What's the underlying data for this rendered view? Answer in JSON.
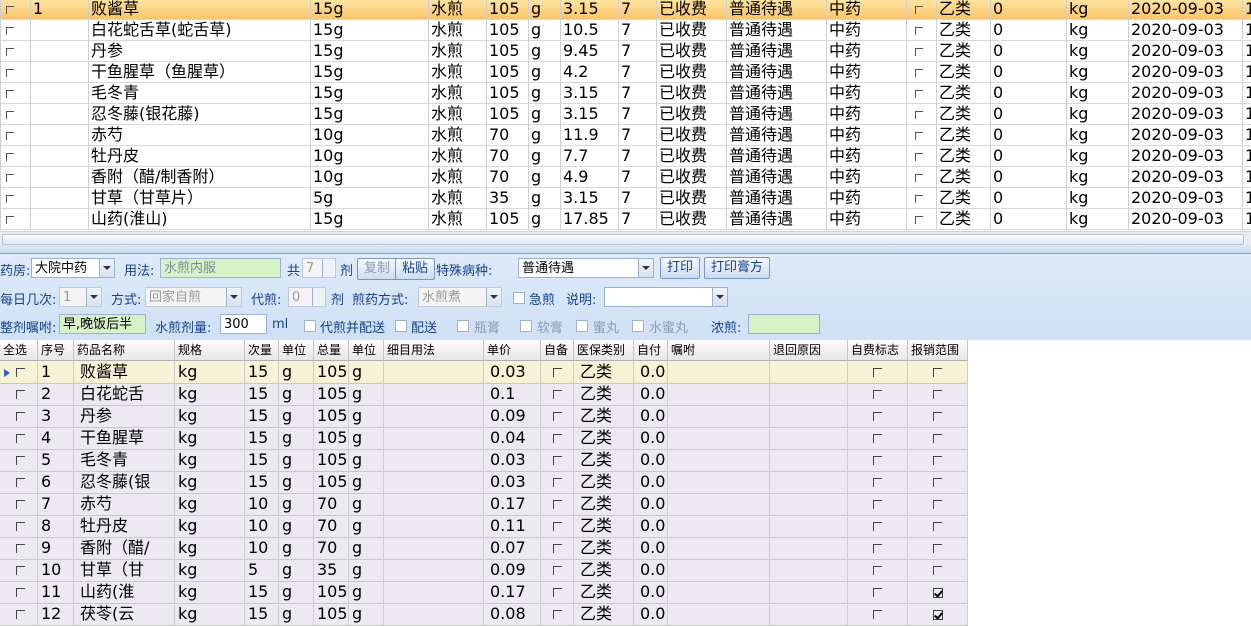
{
  "top_grid": {
    "rows": [
      {
        "no": "1",
        "name": "败酱草",
        "dose": "15g",
        "method": "水煎",
        "qty": "105",
        "unit": "g",
        "price": "3.15",
        "days": "7",
        "status": "已收费",
        "treatment": "普通待遇",
        "kind": "中药",
        "class": "乙类",
        "zero": "0",
        "u2": "kg",
        "date": "2020-09-03",
        "tail": "1"
      },
      {
        "no": "",
        "name": "白花蛇舌草(蛇舌草)",
        "dose": "15g",
        "method": "水煎",
        "qty": "105",
        "unit": "g",
        "price": "10.5",
        "days": "7",
        "status": "已收费",
        "treatment": "普通待遇",
        "kind": "中药",
        "class": "乙类",
        "zero": "0",
        "u2": "kg",
        "date": "2020-09-03",
        "tail": "1"
      },
      {
        "no": "",
        "name": "丹参",
        "dose": "15g",
        "method": "水煎",
        "qty": "105",
        "unit": "g",
        "price": "9.45",
        "days": "7",
        "status": "已收费",
        "treatment": "普通待遇",
        "kind": "中药",
        "class": "乙类",
        "zero": "0",
        "u2": "kg",
        "date": "2020-09-03",
        "tail": "1"
      },
      {
        "no": "",
        "name": "干鱼腥草（鱼腥草）",
        "dose": "15g",
        "method": "水煎",
        "qty": "105",
        "unit": "g",
        "price": "4.2",
        "days": "7",
        "status": "已收费",
        "treatment": "普通待遇",
        "kind": "中药",
        "class": "乙类",
        "zero": "0",
        "u2": "kg",
        "date": "2020-09-03",
        "tail": "1"
      },
      {
        "no": "",
        "name": "毛冬青",
        "dose": "15g",
        "method": "水煎",
        "qty": "105",
        "unit": "g",
        "price": "3.15",
        "days": "7",
        "status": "已收费",
        "treatment": "普通待遇",
        "kind": "中药",
        "class": "乙类",
        "zero": "0",
        "u2": "kg",
        "date": "2020-09-03",
        "tail": "1"
      },
      {
        "no": "",
        "name": "忍冬藤(银花藤)",
        "dose": "15g",
        "method": "水煎",
        "qty": "105",
        "unit": "g",
        "price": "3.15",
        "days": "7",
        "status": "已收费",
        "treatment": "普通待遇",
        "kind": "中药",
        "class": "乙类",
        "zero": "0",
        "u2": "kg",
        "date": "2020-09-03",
        "tail": "1"
      },
      {
        "no": "",
        "name": "赤芍",
        "dose": "10g",
        "method": "水煎",
        "qty": "70",
        "unit": "g",
        "price": "11.9",
        "days": "7",
        "status": "已收费",
        "treatment": "普通待遇",
        "kind": "中药",
        "class": "乙类",
        "zero": "0",
        "u2": "kg",
        "date": "2020-09-03",
        "tail": "1"
      },
      {
        "no": "",
        "name": "牡丹皮",
        "dose": "10g",
        "method": "水煎",
        "qty": "70",
        "unit": "g",
        "price": "7.7",
        "days": "7",
        "status": "已收费",
        "treatment": "普通待遇",
        "kind": "中药",
        "class": "乙类",
        "zero": "0",
        "u2": "kg",
        "date": "2020-09-03",
        "tail": "1"
      },
      {
        "no": "",
        "name": "香附（醋/制香附）",
        "dose": "10g",
        "method": "水煎",
        "qty": "70",
        "unit": "g",
        "price": "4.9",
        "days": "7",
        "status": "已收费",
        "treatment": "普通待遇",
        "kind": "中药",
        "class": "乙类",
        "zero": "0",
        "u2": "kg",
        "date": "2020-09-03",
        "tail": "1"
      },
      {
        "no": "",
        "name": "甘草（甘草片）",
        "dose": "5g",
        "method": "水煎",
        "qty": "35",
        "unit": "g",
        "price": "3.15",
        "days": "7",
        "status": "已收费",
        "treatment": "普通待遇",
        "kind": "中药",
        "class": "乙类",
        "zero": "0",
        "u2": "kg",
        "date": "2020-09-03",
        "tail": "1"
      },
      {
        "no": "",
        "name": "山药(淮山)",
        "dose": "15g",
        "method": "水煎",
        "qty": "105",
        "unit": "g",
        "price": "17.85",
        "days": "7",
        "status": "已收费",
        "treatment": "普通待遇",
        "kind": "中药",
        "class": "乙类",
        "zero": "0",
        "u2": "kg",
        "date": "2020-09-03",
        "tail": "1"
      }
    ]
  },
  "form": {
    "pharmacy_label": "药房:",
    "pharmacy_value": "大院中药",
    "usage_label": "用法:",
    "usage_value": "水煎内服",
    "total_label": "共",
    "total_value": "7",
    "dose_unit": "剂",
    "copy_label": "复制",
    "paste_label": "粘贴",
    "special_label": "特殊病种:",
    "special_value": "普通待遇",
    "print_label": "打印",
    "print_paste_label": "打印膏方",
    "times_label": "每日几次:",
    "times_value": "1",
    "mode_label": "方式:",
    "mode_value": "回家自煎",
    "proxy_label": "代煎:",
    "proxy_value": "0",
    "proxy_unit": "剂",
    "decoct_label": "煎药方式:",
    "decoct_value": "水煎煮",
    "urgent_label": "急煎",
    "note_label": "说明:",
    "note_value": "",
    "advice_label": "整剂嘱咐:",
    "advice_value": "早,晚饭后半小",
    "water_label": "水煎剂量:",
    "water_value": "300",
    "water_unit": "ml",
    "proxy_send_label": "代煎并配送",
    "send_label": "配送",
    "opt1": "瓶膏",
    "opt2": "软膏",
    "opt3": "蜜丸",
    "opt4": "水蜜丸",
    "thick_label": "浓煎:",
    "thick_value": ""
  },
  "bottom_grid": {
    "headers": [
      "全选",
      "序号",
      "药品名称",
      "规格",
      "次量",
      "单位",
      "总量",
      "单位",
      "细目用法",
      "单价",
      "自备",
      "医保类别",
      "自付",
      "嘱咐",
      "退回原因",
      "自费标志",
      "报销范围"
    ],
    "rows": [
      {
        "no": "1",
        "name": "败酱草",
        "spec": "kg",
        "dose": "15",
        "unit": "g",
        "total": "105",
        "unit2": "g",
        "price": "0.03",
        "class": "乙类",
        "self": "0.0",
        "reimb_checked": false
      },
      {
        "no": "2",
        "name": "白花蛇舌",
        "spec": "kg",
        "dose": "15",
        "unit": "g",
        "total": "105",
        "unit2": "g",
        "price": "0.1",
        "class": "乙类",
        "self": "0.0",
        "reimb_checked": false
      },
      {
        "no": "3",
        "name": "丹参",
        "spec": "kg",
        "dose": "15",
        "unit": "g",
        "total": "105",
        "unit2": "g",
        "price": "0.09",
        "class": "乙类",
        "self": "0.0",
        "reimb_checked": false
      },
      {
        "no": "4",
        "name": "干鱼腥草",
        "spec": "kg",
        "dose": "15",
        "unit": "g",
        "total": "105",
        "unit2": "g",
        "price": "0.04",
        "class": "乙类",
        "self": "0.0",
        "reimb_checked": false
      },
      {
        "no": "5",
        "name": "毛冬青",
        "spec": "kg",
        "dose": "15",
        "unit": "g",
        "total": "105",
        "unit2": "g",
        "price": "0.03",
        "class": "乙类",
        "self": "0.0",
        "reimb_checked": false
      },
      {
        "no": "6",
        "name": "忍冬藤(银",
        "spec": "kg",
        "dose": "15",
        "unit": "g",
        "total": "105",
        "unit2": "g",
        "price": "0.03",
        "class": "乙类",
        "self": "0.0",
        "reimb_checked": false
      },
      {
        "no": "7",
        "name": "赤芍",
        "spec": "kg",
        "dose": "10",
        "unit": "g",
        "total": "70",
        "unit2": "g",
        "price": "0.17",
        "class": "乙类",
        "self": "0.0",
        "reimb_checked": false
      },
      {
        "no": "8",
        "name": "牡丹皮",
        "spec": "kg",
        "dose": "10",
        "unit": "g",
        "total": "70",
        "unit2": "g",
        "price": "0.11",
        "class": "乙类",
        "self": "0.0",
        "reimb_checked": false
      },
      {
        "no": "9",
        "name": "香附（醋/",
        "spec": "kg",
        "dose": "10",
        "unit": "g",
        "total": "70",
        "unit2": "g",
        "price": "0.07",
        "class": "乙类",
        "self": "0.0",
        "reimb_checked": false
      },
      {
        "no": "10",
        "name": "甘草（甘",
        "spec": "kg",
        "dose": "5",
        "unit": "g",
        "total": "35",
        "unit2": "g",
        "price": "0.09",
        "class": "乙类",
        "self": "0.0",
        "reimb_checked": false
      },
      {
        "no": "11",
        "name": "山药(淮",
        "spec": "kg",
        "dose": "15",
        "unit": "g",
        "total": "105",
        "unit2": "g",
        "price": "0.17",
        "class": "乙类",
        "self": "0.0",
        "reimb_checked": true
      },
      {
        "no": "12",
        "name": "茯苓(云",
        "spec": "kg",
        "dose": "15",
        "unit": "g",
        "total": "105",
        "unit2": "g",
        "price": "0.08",
        "class": "乙类",
        "self": "0.0",
        "reimb_checked": true
      }
    ]
  },
  "colors": {
    "selected_row": "#fbc56a",
    "toolbar_bg": "#dfeafa",
    "label_blue": "#15428b",
    "green_field": "#d6f2c6"
  }
}
